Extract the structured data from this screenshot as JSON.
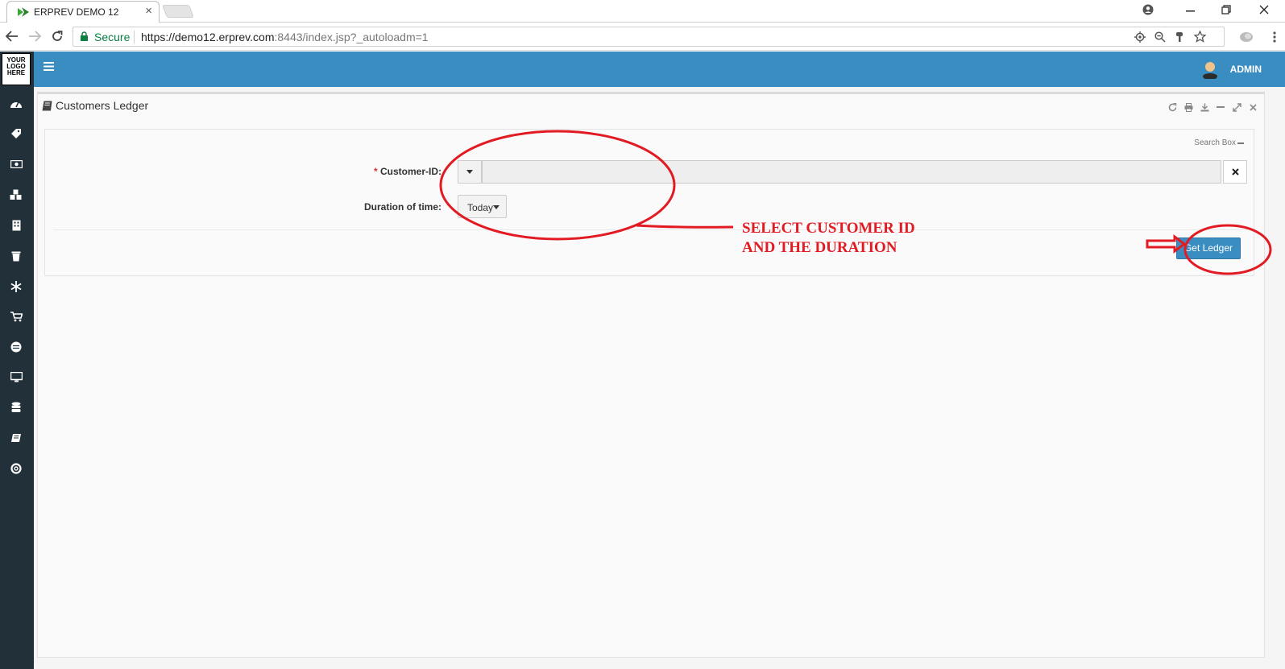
{
  "browser": {
    "tab_title": "ERPREV DEMO 12",
    "tab_close": "×",
    "secure_label": "Secure",
    "url_main": "https://demo12.erprev.com",
    "url_rest": ":8443/index.jsp?_autoloadm=1"
  },
  "app": {
    "logo_text": "YOUR LOGO HERE",
    "user_label": "ADMIN"
  },
  "panel": {
    "title": "Customers Ledger",
    "search_box_label": "Search Box",
    "customer_id_required": "* ",
    "customer_id_label": "Customer-ID:",
    "duration_label": "Duration of time:",
    "duration_value": "Today",
    "get_ledger_label": "Get Ledger"
  },
  "annotation": {
    "line1": "SELECT CUSTOMER ID",
    "line2": "AND THE DURATION"
  },
  "colors": {
    "accent": "#3a8dc1",
    "sidebar": "#22303a",
    "annotation": "#e21b23"
  }
}
